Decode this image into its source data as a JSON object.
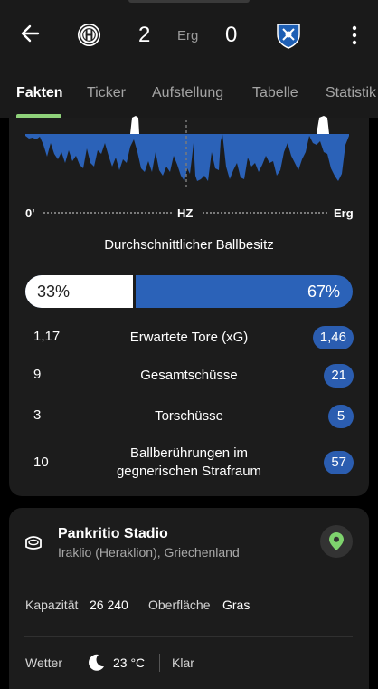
{
  "match": {
    "home_score": "2",
    "status": "Erg",
    "away_score": "0"
  },
  "tabs": [
    "Fakten",
    "Ticker",
    "Aufstellung",
    "Tabelle",
    "Statistik"
  ],
  "timeline": {
    "start": "0'",
    "half": "HZ",
    "end": "Erg"
  },
  "possession": {
    "title": "Durchschnittlicher Ballbesitz",
    "home_pct": 33,
    "away_pct": 67,
    "home_label": "33%",
    "away_label": "67%"
  },
  "stats": [
    {
      "home": "1,17",
      "label": "Erwartete Tore (xG)",
      "away": "1,46"
    },
    {
      "home": "9",
      "label": "Gesamtschüsse",
      "away": "21"
    },
    {
      "home": "3",
      "label": "Torschüsse",
      "away": "5"
    },
    {
      "home": "10",
      "label": "Ballberührungen im gegnerischen Strafraum",
      "away": "57"
    }
  ],
  "venue": {
    "name": "Pankritio Stadio",
    "location": "Iraklio (Heraklion), Griechenland",
    "capacity_label": "Kapazität",
    "capacity_value": "26 240",
    "surface_label": "Oberfläche",
    "surface_value": "Gras",
    "weather_label": "Wetter",
    "temperature": "23 °C",
    "condition": "Klar"
  },
  "colors": {
    "accent": "#8fd17a",
    "away_blue": "#2b62b8",
    "pin_green": "#7ed36d"
  },
  "icons": [
    "back-arrow-icon",
    "home-team-logo",
    "away-team-logo",
    "more-vert-icon",
    "stadium-icon",
    "location-pin-icon",
    "moon-icon"
  ]
}
